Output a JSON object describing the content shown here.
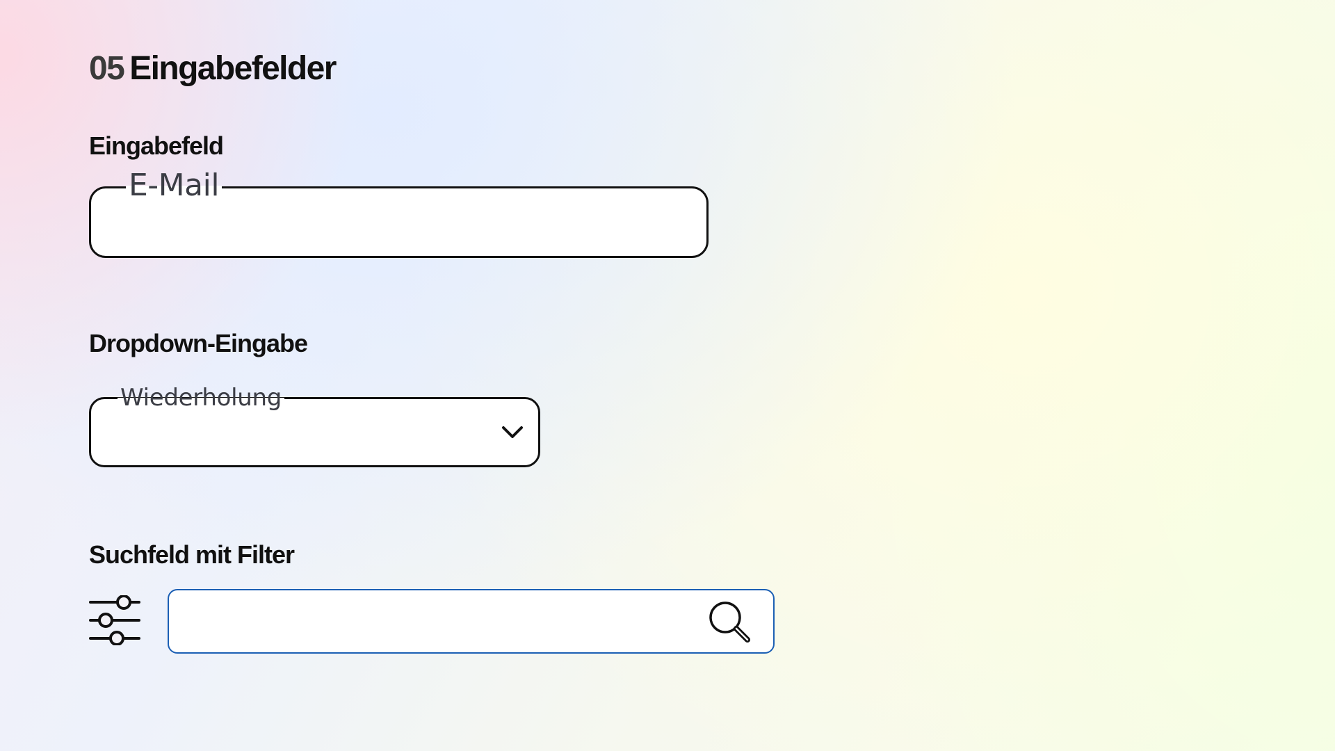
{
  "page": {
    "title_number": "05",
    "title_text": "Eingabefelder"
  },
  "sections": {
    "input": {
      "heading": "Eingabefeld",
      "label": "E-Mail"
    },
    "dropdown": {
      "heading": "Dropdown-Eingabe",
      "label": "Wiederholung",
      "icon": "chevron-down-icon"
    },
    "search": {
      "heading": "Suchfeld mit Filter",
      "filter_icon": "filter-sliders-icon",
      "search_icon": "search-icon",
      "border_color": "#1b5fb4"
    }
  }
}
